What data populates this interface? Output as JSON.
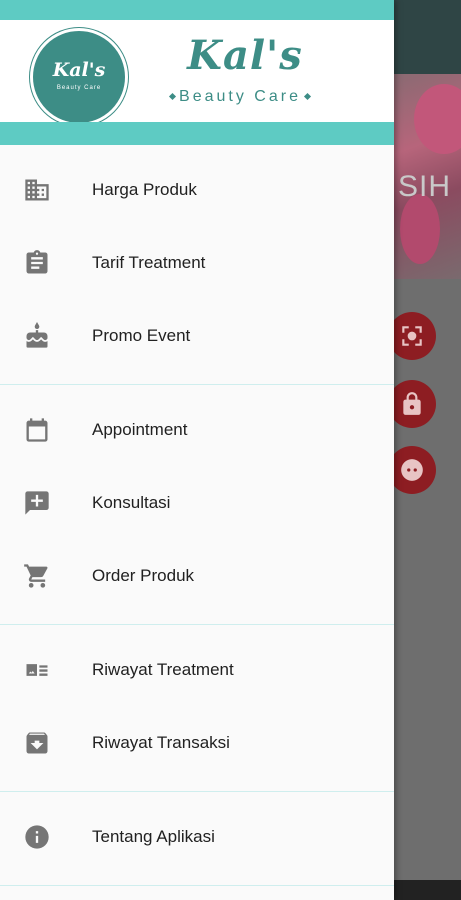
{
  "header": {
    "logo_circle_name": "Kal's",
    "logo_circle_sub": "Beauty Care",
    "brand_name": "Kal's",
    "brand_tagline": "Beauty Care"
  },
  "background": {
    "partial_text": "SIH"
  },
  "menu": {
    "section1": [
      {
        "label": "Harga Produk",
        "icon": "building-icon"
      },
      {
        "label": "Tarif Treatment",
        "icon": "clipboard-icon"
      },
      {
        "label": "Promo Event",
        "icon": "cake-icon"
      }
    ],
    "section2": [
      {
        "label": "Appointment",
        "icon": "calendar-icon"
      },
      {
        "label": "Konsultasi",
        "icon": "add-comment-icon"
      },
      {
        "label": "Order Produk",
        "icon": "cart-icon"
      }
    ],
    "section3": [
      {
        "label": "Riwayat Treatment",
        "icon": "image-list-icon"
      },
      {
        "label": "Riwayat Transaksi",
        "icon": "archive-icon"
      }
    ],
    "section4": [
      {
        "label": "Tentang Aplikasi",
        "icon": "info-icon"
      }
    ]
  },
  "colors": {
    "accent": "#5ecbc3",
    "brand": "#3d8d86",
    "fab": "#8d1d22"
  }
}
